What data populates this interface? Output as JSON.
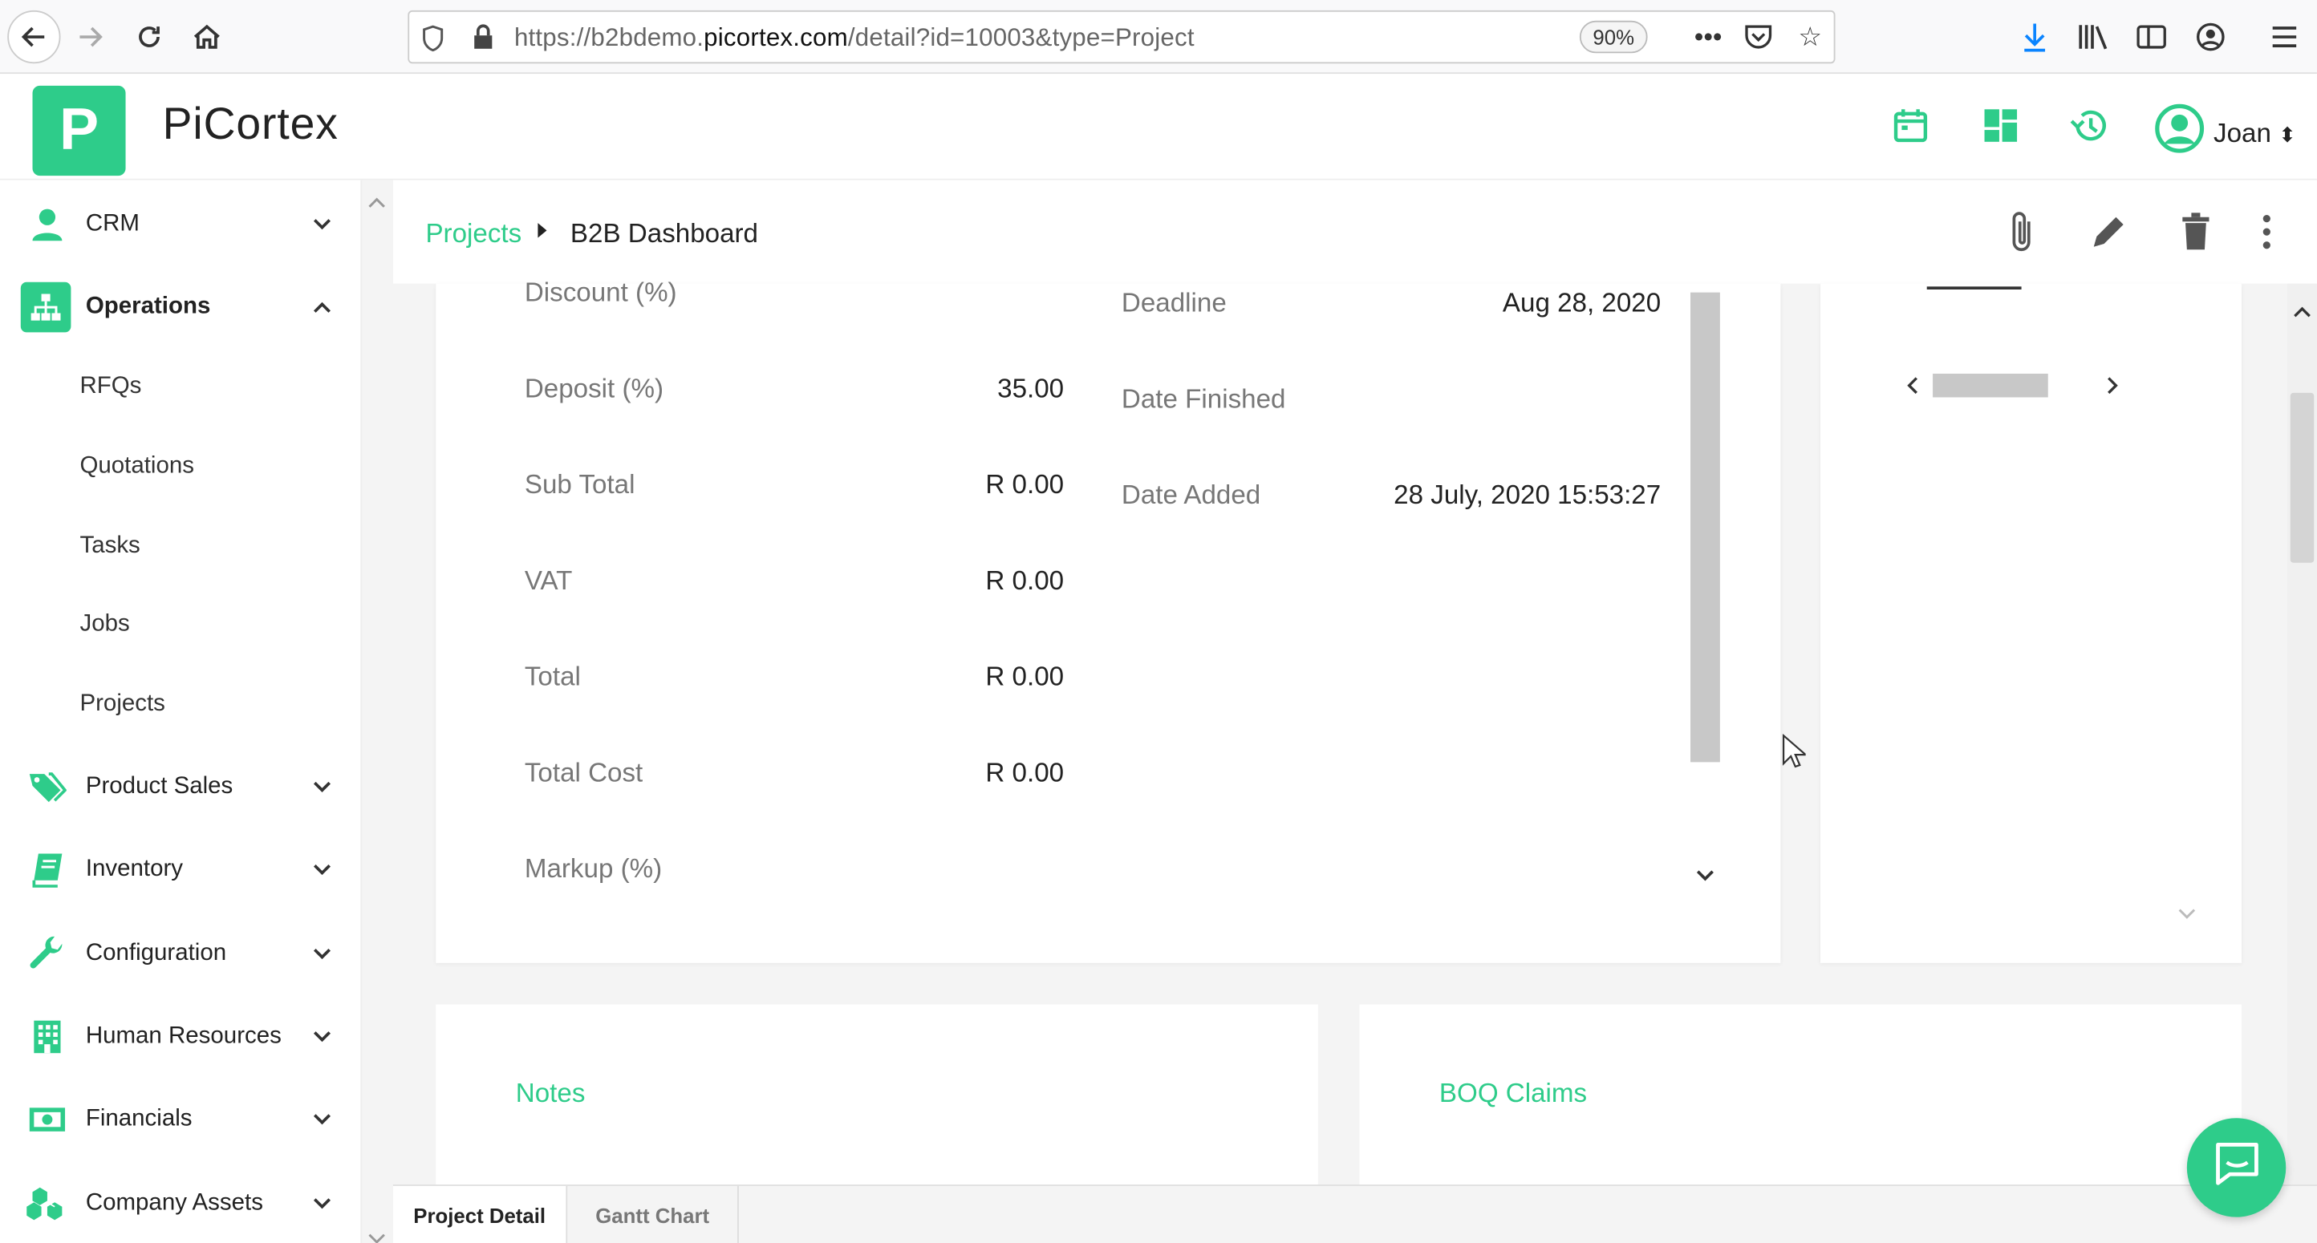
{
  "browser": {
    "url_prefix": "https://b2bdemo.",
    "url_domain": "picortex.com",
    "url_path": "/detail?id=10003&type=Project",
    "zoom": "90%"
  },
  "app": {
    "brand": "PiCortex",
    "logo_letter": "P",
    "user_name": "Joan",
    "accent_color": "#2ecc8a"
  },
  "sidebar": {
    "items": [
      {
        "label": "CRM",
        "icon": "person-icon"
      },
      {
        "label": "Operations",
        "icon": "org-chart-icon"
      },
      {
        "label": "Product Sales",
        "icon": "tags-icon"
      },
      {
        "label": "Inventory",
        "icon": "book-icon"
      },
      {
        "label": "Configuration",
        "icon": "wrench-icon"
      },
      {
        "label": "Human Resources",
        "icon": "building-icon"
      },
      {
        "label": "Financials",
        "icon": "money-icon"
      },
      {
        "label": "Company Assets",
        "icon": "cubes-icon"
      }
    ],
    "operations_sub": [
      "RFQs",
      "Quotations",
      "Tasks",
      "Jobs",
      "Projects"
    ]
  },
  "breadcrumb": {
    "parent": "Projects",
    "current": "B2B Dashboard"
  },
  "details_left": [
    {
      "label": "Discount (%)",
      "value": ""
    },
    {
      "label": "Deposit (%)",
      "value": "35.00"
    },
    {
      "label": "Sub Total",
      "value": "R 0.00"
    },
    {
      "label": "VAT",
      "value": "R 0.00"
    },
    {
      "label": "Total",
      "value": "R 0.00"
    },
    {
      "label": "Total Cost",
      "value": "R 0.00"
    },
    {
      "label": "Markup (%)",
      "value": ""
    }
  ],
  "details_right": [
    {
      "label": "Deadline",
      "value": "Aug 28, 2020"
    },
    {
      "label": "Date Finished",
      "value": ""
    },
    {
      "label": "Date Added",
      "value": "28 July, 2020 15:53:27"
    }
  ],
  "cards": {
    "notes_title": "Notes",
    "boq_title": "BOQ Claims"
  },
  "tabs": [
    "Project Detail",
    "Gantt Chart"
  ]
}
